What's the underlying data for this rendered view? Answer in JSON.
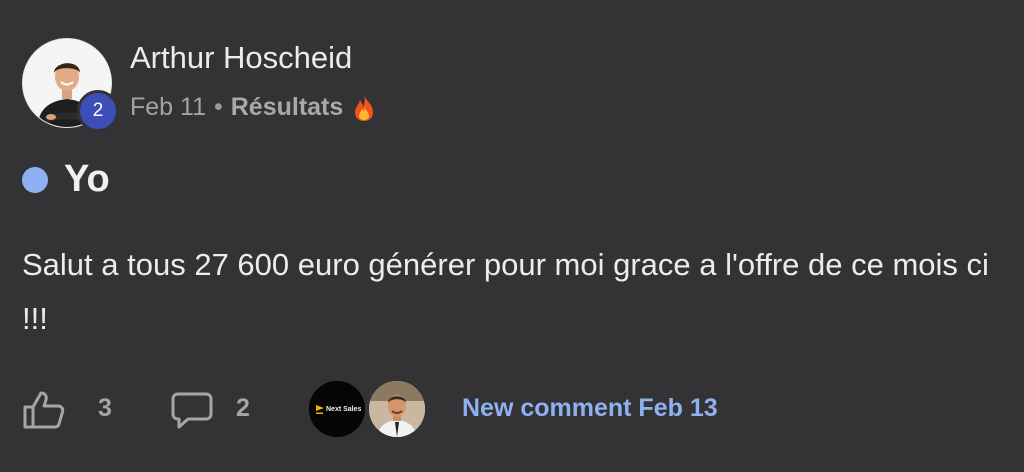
{
  "post": {
    "author": {
      "name": "Arthur Hoscheid",
      "level": "2"
    },
    "date": "Feb 11",
    "separator": "•",
    "category": "Résultats",
    "category_icon": "fire-icon",
    "title": "Yo",
    "body": "Salut a tous 27 600 euro générer pour moi grace a l'offre de ce mois ci !!!",
    "likes": "3",
    "comments": "2",
    "last_comment": "New comment Feb 13",
    "commenters": [
      {
        "logo_text": "Next Sales"
      },
      {
        "avatar": "person-avatar"
      }
    ]
  },
  "colors": {
    "background": "#333234",
    "accent": "#8fb1f1",
    "level_badge": "#3d4fb6"
  }
}
